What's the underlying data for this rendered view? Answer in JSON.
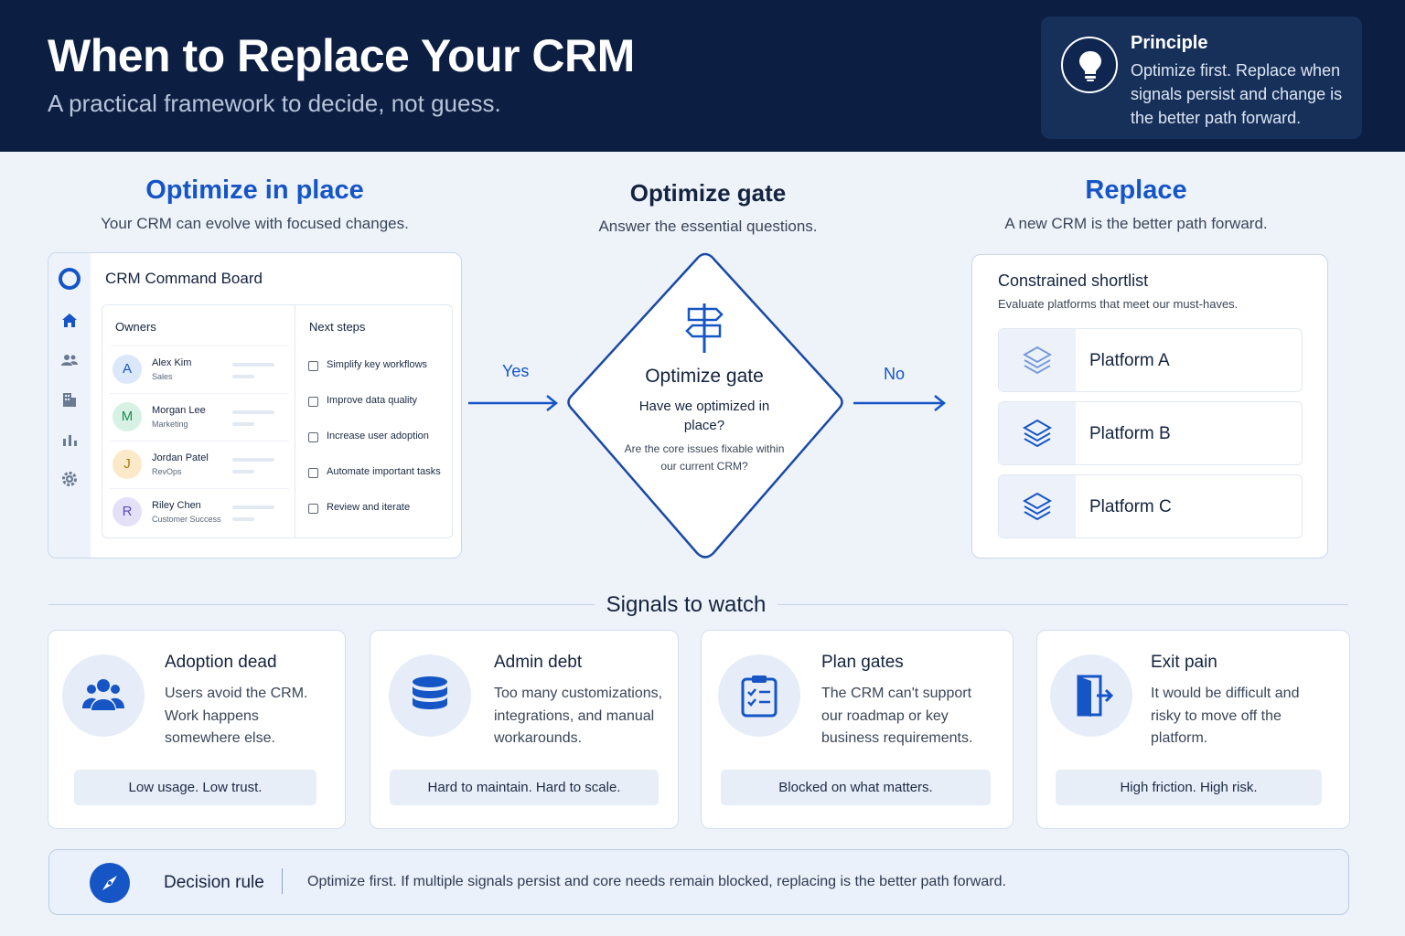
{
  "header": {
    "title": "When to Replace Your CRM",
    "subtitle": "A practical framework to decide, not guess.",
    "principle": {
      "title": "Principle",
      "text": "Optimize first. Replace when signals persist and change is the better path forward.",
      "icon": "lightbulb-icon"
    }
  },
  "columns": {
    "optimize": {
      "title": "Optimize in place",
      "subtitle": "Your CRM can evolve with focused changes."
    },
    "gate": {
      "title": "Optimize gate",
      "subtitle": "Answer the essential questions."
    },
    "replace": {
      "title": "Replace",
      "subtitle": "A new CRM is the better path forward."
    }
  },
  "crm_board": {
    "title": "CRM Command Board",
    "owners_heading": "Owners",
    "next_steps_heading": "Next steps",
    "owners": [
      {
        "initial": "A",
        "name": "Alex Kim",
        "role": "Sales",
        "color": "#dbe8fb",
        "text_color": "#1555c6"
      },
      {
        "initial": "M",
        "name": "Morgan Lee",
        "role": "Marketing",
        "color": "#d7f2e4",
        "text_color": "#1d8a57"
      },
      {
        "initial": "J",
        "name": "Jordan Patel",
        "role": "RevOps",
        "color": "#fbe9c9",
        "text_color": "#b07a12"
      },
      {
        "initial": "R",
        "name": "Riley Chen",
        "role": "Customer Success",
        "color": "#e4e0f8",
        "text_color": "#5a4bc2"
      }
    ],
    "next_steps": [
      "Simplify key workflows",
      "Improve data quality",
      "Increase user adoption",
      "Automate important tasks",
      "Review and iterate"
    ],
    "rail_icons": [
      "home-icon",
      "users-icon",
      "building-icon",
      "chart-icon",
      "settings-icon"
    ]
  },
  "flow": {
    "yes": "Yes",
    "no": "No"
  },
  "gate": {
    "title": "Optimize gate",
    "question": "Have we optimized in place?",
    "note": "Are the core issues fixable within our current CRM?",
    "icon": "signpost-icon"
  },
  "shortlist": {
    "title": "Constrained shortlist",
    "subtitle": "Evaluate platforms that meet our must-haves.",
    "platforms": [
      "Platform A",
      "Platform B",
      "Platform C"
    ]
  },
  "signals": {
    "heading": "Signals to watch",
    "items": [
      {
        "title": "Adoption dead",
        "text": "Users avoid the CRM. Work happens somewhere else.",
        "pill": "Low usage. Low trust.",
        "icon": "users-group-icon"
      },
      {
        "title": "Admin debt",
        "text": "Too many customizations, integrations, and manual workarounds.",
        "pill": "Hard to maintain. Hard to scale.",
        "icon": "database-icon"
      },
      {
        "title": "Plan gates",
        "text": "The CRM can't support our roadmap or key business requirements.",
        "pill": "Blocked on what matters.",
        "icon": "clipboard-checklist-icon"
      },
      {
        "title": "Exit pain",
        "text": "It would be difficult and risky to move off the platform.",
        "pill": "High friction. High risk.",
        "icon": "exit-door-icon"
      }
    ]
  },
  "decision_rule": {
    "label": "Decision rule",
    "text": "Optimize first. If multiple signals persist and core needs remain blocked, replacing is the better path forward.",
    "icon": "compass-icon"
  },
  "colors": {
    "navy": "#0c1f42",
    "accent": "#1555c6",
    "background": "#eef3fa"
  }
}
